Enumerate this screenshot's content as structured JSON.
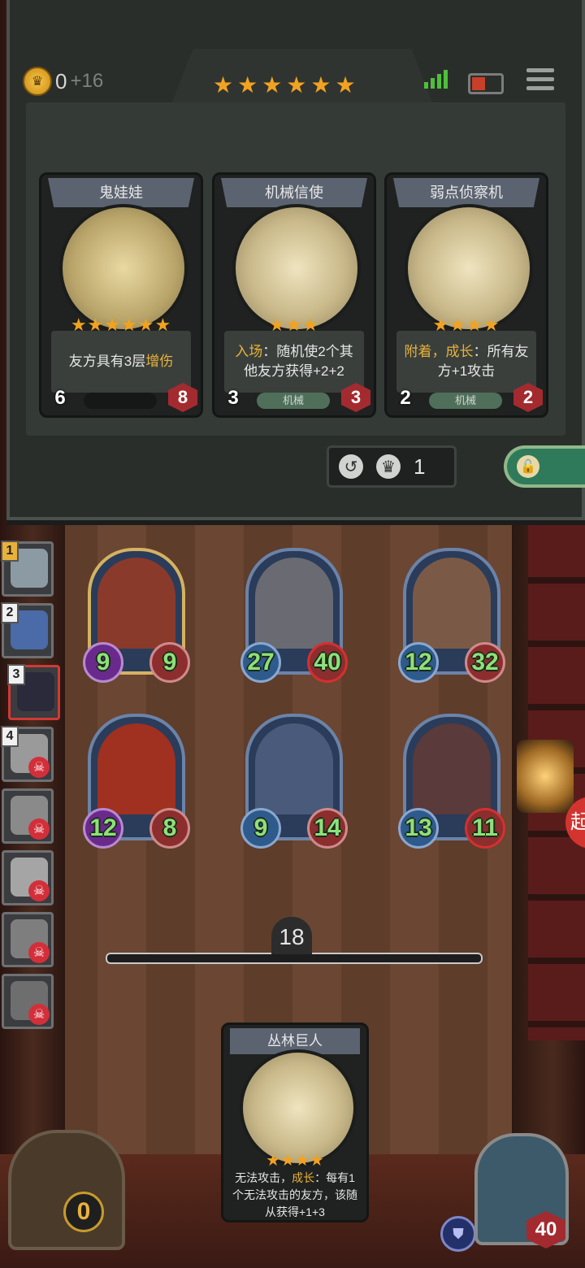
{
  "header": {
    "gold": "0",
    "gold_income": "+16",
    "tavern_stars": "★★★★★★"
  },
  "shop_cards": [
    {
      "name": "鬼娃娃",
      "stars": "★★★★★★",
      "desc_pre": "友方具有3层",
      "desc_hl": "增伤",
      "desc_post": "",
      "tag": "",
      "attack": "6",
      "health": "8"
    },
    {
      "name": "机械信使",
      "stars": "★★★",
      "desc_pre": "",
      "desc_hl": "入场",
      "desc_post": "：随机使2个其他友方获得+2+2",
      "tag": "机械",
      "attack": "3",
      "health": "3"
    },
    {
      "name": "弱点侦察机",
      "stars": "★★★★",
      "desc_pre": "",
      "desc_hl": "附着，成长",
      "desc_post": "：所有友方+1攻击",
      "tag": "机械",
      "attack": "2",
      "health": "2"
    }
  ],
  "refresh": {
    "cost": "1"
  },
  "opponents": [
    {
      "rank": "1",
      "dead": false
    },
    {
      "rank": "2",
      "dead": false
    },
    {
      "rank": "3",
      "dead": false
    },
    {
      "rank": "4",
      "dead": true
    },
    {
      "rank": "",
      "dead": true
    },
    {
      "rank": "",
      "dead": true
    },
    {
      "rank": "",
      "dead": true
    },
    {
      "rank": "",
      "dead": true
    }
  ],
  "board": [
    {
      "attack": "9",
      "health": "9"
    },
    {
      "attack": "27",
      "health": "40"
    },
    {
      "attack": "12",
      "health": "32"
    },
    {
      "attack": "12",
      "health": "8"
    },
    {
      "attack": "9",
      "health": "14"
    },
    {
      "attack": "13",
      "health": "11"
    }
  ],
  "turn": "18",
  "hand_card": {
    "name": "丛林巨人",
    "stars": "★★★★",
    "desc_pre": "无法攻击，",
    "desc_hl": "成长",
    "desc_post": "：每有1个无法攻击的友方，该随从获得+1+3"
  },
  "player": {
    "gold": "0",
    "health": "40"
  },
  "fight_label": "起",
  "colors": {
    "star": "#f2a221",
    "highlight": "#e8b23a",
    "attack_text": "#8ee07a"
  }
}
